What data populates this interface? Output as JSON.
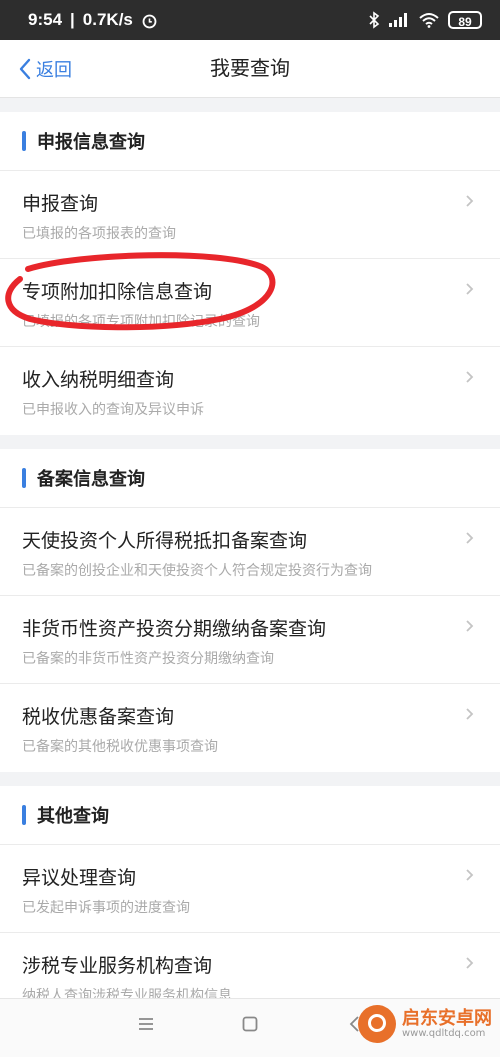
{
  "status": {
    "time": "9:54",
    "speed": "0.7K/s",
    "battery": "89"
  },
  "nav": {
    "back": "返回",
    "title": "我要查询"
  },
  "sections": [
    {
      "header": "申报信息查询",
      "items": [
        {
          "title": "申报查询",
          "subtitle": "已填报的各项报表的查询"
        },
        {
          "title": "专项附加扣除信息查询",
          "subtitle": "已填报的各项专项附加扣除记录的查询"
        },
        {
          "title": "收入纳税明细查询",
          "subtitle": "已申报收入的查询及异议申诉"
        }
      ]
    },
    {
      "header": "备案信息查询",
      "items": [
        {
          "title": "天使投资个人所得税抵扣备案查询",
          "subtitle": "已备案的创投企业和天使投资个人符合规定投资行为查询"
        },
        {
          "title": "非货币性资产投资分期缴纳备案查询",
          "subtitle": "已备案的非货币性资产投资分期缴纳查询"
        },
        {
          "title": "税收优惠备案查询",
          "subtitle": "已备案的其他税收优惠事项查询"
        }
      ]
    },
    {
      "header": "其他查询",
      "items": [
        {
          "title": "异议处理查询",
          "subtitle": "已发起申诉事项的进度查询"
        },
        {
          "title": "涉税专业服务机构查询",
          "subtitle": "纳税人查询涉税专业服务机构信息"
        }
      ]
    }
  ],
  "watermark": {
    "name": "启东安卓网",
    "url": "www.qdltdq.com"
  },
  "colors": {
    "accent": "#3a7fe0",
    "annotation": "#e8262b",
    "status_bar": "#2d2d2d"
  }
}
